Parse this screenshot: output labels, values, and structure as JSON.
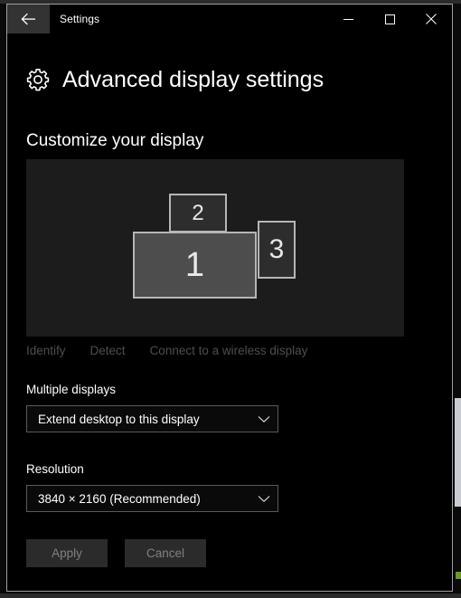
{
  "window": {
    "title": "Settings",
    "back_icon": "back-arrow-icon",
    "controls": {
      "minimize": "minimize-icon",
      "maximize": "maximize-icon",
      "close": "close-icon"
    }
  },
  "header": {
    "icon": "gear-icon",
    "title": "Advanced display settings",
    "section_title": "Customize your display"
  },
  "display_preview": {
    "monitors": [
      {
        "number": "1",
        "selected": true,
        "orientation": "landscape"
      },
      {
        "number": "2",
        "selected": false,
        "orientation": "landscape"
      },
      {
        "number": "3",
        "selected": false,
        "orientation": "portrait"
      }
    ]
  },
  "links": {
    "identify": "Identify",
    "detect": "Detect",
    "wireless": "Connect to a wireless display"
  },
  "multiple_displays": {
    "label": "Multiple displays",
    "value": "Extend desktop to this display",
    "chevron_icon": "chevron-down-icon"
  },
  "resolution": {
    "label": "Resolution",
    "value": "3840 × 2160 (Recommended)",
    "chevron_icon": "chevron-down-icon"
  },
  "actions": {
    "apply": "Apply",
    "cancel": "Cancel"
  },
  "colors": {
    "window_background": "#000000",
    "window_border": "#9aa0a6",
    "preview_background": "#1c1c1c",
    "monitor_selected_fill": "#4d4d4d",
    "monitor_unselected_fill": "#2d2d2d",
    "monitor_border": "#b6b6b6",
    "text_primary": "#ffffff",
    "text_disabled": "#4e4e4e",
    "button_background": "#2b2b2b",
    "button_text_disabled": "#808080",
    "dropdown_border": "#5a5a5a"
  }
}
